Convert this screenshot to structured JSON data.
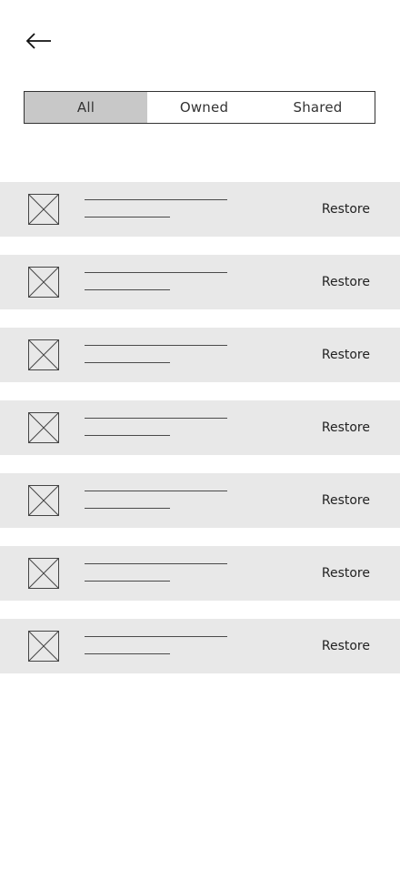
{
  "header": {
    "back_icon": "arrow-left-icon"
  },
  "filter_tabs": [
    {
      "label": "All",
      "selected": true
    },
    {
      "label": "Owned",
      "selected": false
    },
    {
      "label": "Shared",
      "selected": false
    }
  ],
  "colors": {
    "selected_tab_bg": "#c8c8c8",
    "row_bg": "#e8e8e8",
    "line": "#4a4a4a"
  },
  "items": [
    {
      "thumbnail_icon": "image-placeholder-icon",
      "action_label": "Restore"
    },
    {
      "thumbnail_icon": "image-placeholder-icon",
      "action_label": "Restore"
    },
    {
      "thumbnail_icon": "image-placeholder-icon",
      "action_label": "Restore"
    },
    {
      "thumbnail_icon": "image-placeholder-icon",
      "action_label": "Restore"
    },
    {
      "thumbnail_icon": "image-placeholder-icon",
      "action_label": "Restore"
    },
    {
      "thumbnail_icon": "image-placeholder-icon",
      "action_label": "Restore"
    },
    {
      "thumbnail_icon": "image-placeholder-icon",
      "action_label": "Restore"
    }
  ]
}
